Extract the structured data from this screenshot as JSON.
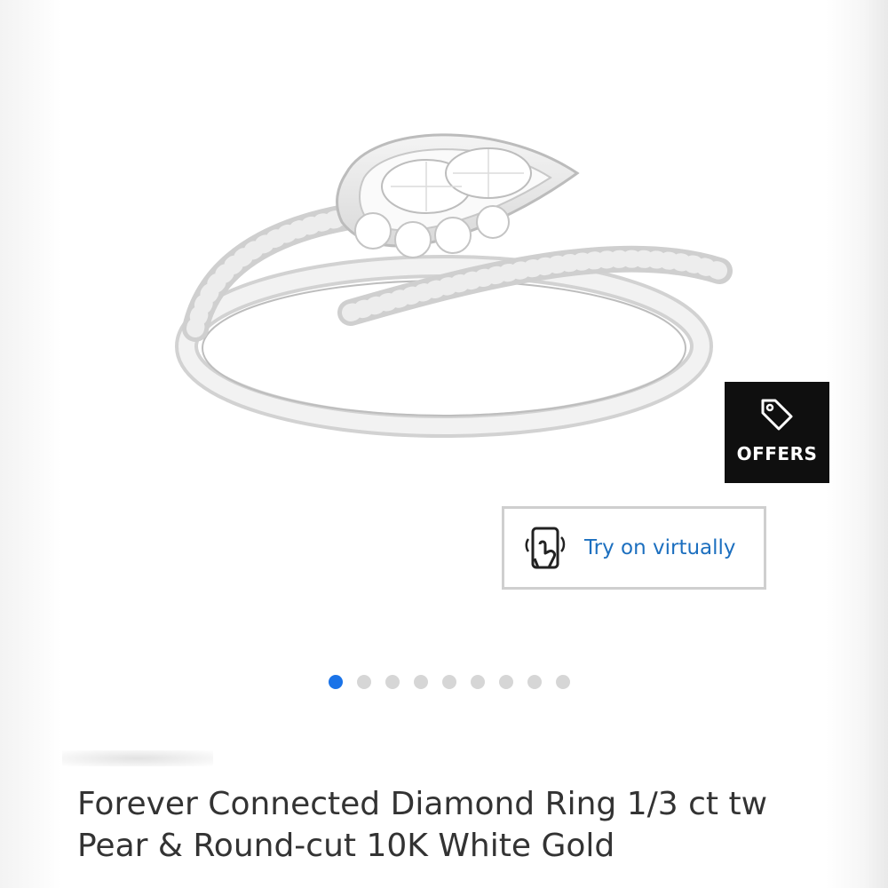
{
  "product": {
    "title_line1": "Forever Connected Diamond Ring 1/3 ct tw",
    "title_line2": "Pear & Round-cut 10K White Gold",
    "image_icon": "ring-image"
  },
  "offers": {
    "label": "OFFERS",
    "icon": "tag-icon",
    "background": "#0f0f0f"
  },
  "try_on": {
    "label": "Try on virtually",
    "icon": "hand-phone-icon",
    "label_color": "#1c6fbf",
    "border_color": "#cfcfcf"
  },
  "carousel": {
    "total": 9,
    "active_index": 0,
    "active_color": "#1a73e8",
    "inactive_color": "#d6d6d6"
  }
}
